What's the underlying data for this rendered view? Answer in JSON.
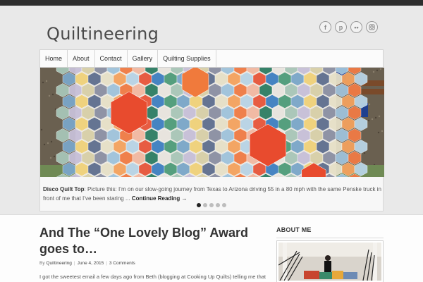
{
  "site": {
    "title": "Quiltineering"
  },
  "social": [
    {
      "icon": "facebook-icon",
      "glyph": "f"
    },
    {
      "icon": "pinterest-icon",
      "glyph": "p"
    },
    {
      "icon": "flickr-icon",
      "glyph": "••"
    },
    {
      "icon": "instagram-icon",
      "glyph": ""
    }
  ],
  "nav": {
    "items": [
      "Home",
      "About",
      "Contact",
      "Gallery",
      "Quilting Supplies"
    ]
  },
  "slider": {
    "caption_title": "Disco Quilt Top",
    "caption_text": ": Picture this: I’m on our slow-going journey from Texas to Arizona driving 55 in a 80 mph with the same Penske truck in front of me that I’ve been staring ... ",
    "caption_link": "Continue Reading →",
    "slide_count": 5,
    "active_slide": 1
  },
  "post": {
    "title": "And The “One Lovely Blog” Award goes to…",
    "meta_prefix": "By ",
    "author": "Quiltineering",
    "date": "June 4, 2015",
    "comments": "3 Comments",
    "excerpt": "I got the sweetest email a few days ago from Beth (blogging at Cooking Up Quilts) telling me that she"
  },
  "sidebar": {
    "about_heading": "ABOUT ME"
  }
}
